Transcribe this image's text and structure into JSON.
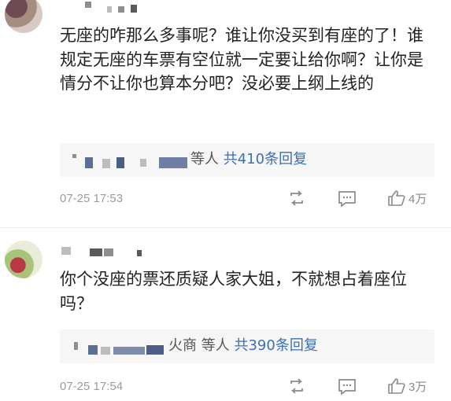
{
  "comments": [
    {
      "body": "无座的咋那么多事呢？谁让你没买到有座的了！谁规定无座的车票有空位就一定要让给你啊？让你是情分不让你也算本分吧？没必要上纲上线的",
      "reply_summary": {
        "suffix": "等人",
        "count_text": "共410条回复"
      },
      "timestamp": "07-25 17:53",
      "like_count": "4万",
      "avatar_icon": "user-avatar-pixelated",
      "actions": [
        "repost-icon",
        "comment-icon",
        "like-icon"
      ]
    },
    {
      "body": "你个没座的票还质疑人家大姐，不就想占着座位吗？",
      "reply_summary": {
        "suffix": "火商 等人",
        "count_text": "共390条回复"
      },
      "timestamp": "07-25 17:54",
      "like_count": "3万",
      "avatar_icon": "user-avatar-pixelated",
      "actions": [
        "repost-icon",
        "comment-icon",
        "like-icon"
      ]
    }
  ],
  "colors": {
    "link": "#3b6fb3",
    "meta": "#9b9b9b",
    "reply_bg": "#f6f6f6",
    "text": "#222222"
  }
}
